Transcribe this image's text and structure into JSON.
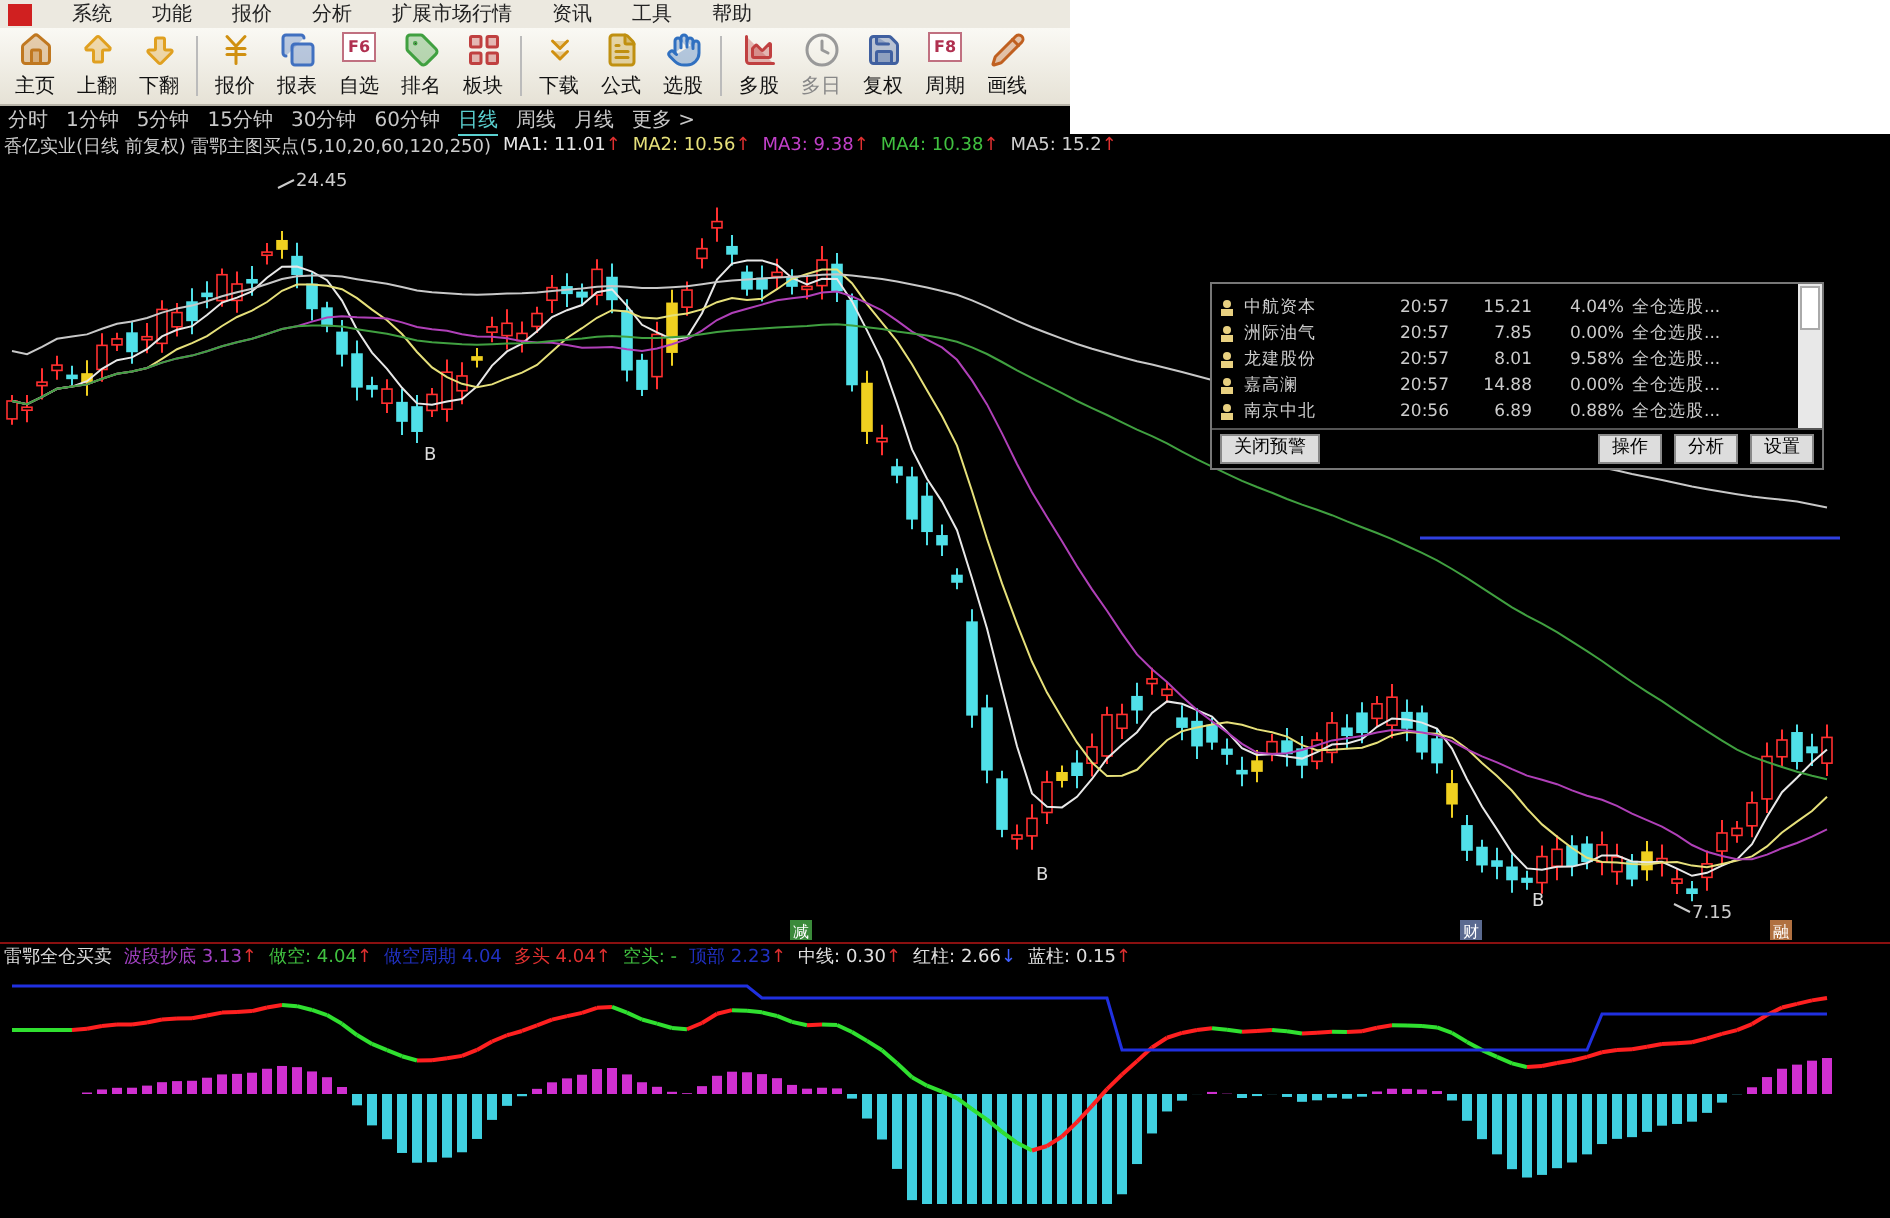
{
  "menu": [
    "系统",
    "功能",
    "报价",
    "分析",
    "扩展市场行情",
    "资讯",
    "工具",
    "帮助"
  ],
  "toolbar": [
    {
      "label": "主页",
      "disabled": false
    },
    {
      "label": "上翻",
      "disabled": false
    },
    {
      "label": "下翻",
      "disabled": false
    },
    {
      "label": "报价",
      "disabled": false
    },
    {
      "label": "报表",
      "disabled": false
    },
    {
      "label": "自选",
      "key": "F6",
      "disabled": false
    },
    {
      "label": "排名",
      "disabled": false
    },
    {
      "label": "板块",
      "disabled": false
    },
    {
      "label": "下载",
      "disabled": false
    },
    {
      "label": "公式",
      "disabled": false
    },
    {
      "label": "选股",
      "disabled": false
    },
    {
      "label": "多股",
      "disabled": false
    },
    {
      "label": "多日",
      "disabled": true
    },
    {
      "label": "复权",
      "disabled": false
    },
    {
      "label": "周期",
      "key": "F8",
      "disabled": false
    },
    {
      "label": "画线",
      "disabled": false
    }
  ],
  "periods": [
    {
      "label": "分时",
      "selected": false
    },
    {
      "label": "1分钟",
      "selected": false
    },
    {
      "label": "5分钟",
      "selected": false
    },
    {
      "label": "15分钟",
      "selected": false
    },
    {
      "label": "30分钟",
      "selected": false
    },
    {
      "label": "60分钟",
      "selected": false
    },
    {
      "label": "日线",
      "selected": true
    },
    {
      "label": "周线",
      "selected": false
    },
    {
      "label": "月线",
      "selected": false
    },
    {
      "label": "更多 >",
      "selected": false
    }
  ],
  "chart_title": "香亿实业(日线 前复权) 雷鄂主图买点(5,10,20,60,120,250)",
  "ma": [
    {
      "label": "MA1: 11.01",
      "color": "#e8e8e8"
    },
    {
      "label": "MA2: 10.56",
      "color": "#e6e07a"
    },
    {
      "label": "MA3: 9.38",
      "color": "#c040c8"
    },
    {
      "label": "MA4: 10.38",
      "color": "#40c040"
    },
    {
      "label": "MA5: 15.2",
      "color": "#d0d0d0"
    }
  ],
  "price_labels": [
    "24.45",
    "7.15"
  ],
  "buy_marks": [
    "B",
    "B",
    "B"
  ],
  "event_tags": [
    {
      "text": "减",
      "color": "#3a8a3a"
    },
    {
      "text": "财",
      "color": "#5a6a90"
    },
    {
      "text": "融",
      "color": "#b07040"
    }
  ],
  "alert_panel": {
    "rows": [
      {
        "name": "中航资本",
        "time": "20:57",
        "price": "15.21",
        "change": "4.04%",
        "strategy": "全仓选股..."
      },
      {
        "name": "洲际油气",
        "time": "20:57",
        "price": "7.85",
        "change": "0.00%",
        "strategy": "全仓选股..."
      },
      {
        "name": "龙建股份",
        "time": "20:57",
        "price": "8.01",
        "change": "9.58%",
        "strategy": "全仓选股..."
      },
      {
        "name": "嘉高澜",
        "time": "20:57",
        "price": "14.88",
        "change": "0.00%",
        "strategy": "全仓选股..."
      },
      {
        "name": "南京中北",
        "time": "20:56",
        "price": "6.89",
        "change": "0.88%",
        "strategy": "全仓选股..."
      }
    ],
    "close_button": "关闭预警",
    "buttons": [
      "操作",
      "分析",
      "设置"
    ]
  },
  "indicator": {
    "title": "雷鄂全仓买卖",
    "values": [
      {
        "label": "波段抄底",
        "value": "3.13",
        "arrow": "↑",
        "color": "#a040c0"
      },
      {
        "label": "做空:",
        "value": "4.04",
        "arrow": "↑",
        "color": "#40c040"
      },
      {
        "label": "做空周期",
        "value": "4.04",
        "color": "#2030c0"
      },
      {
        "label": "多头",
        "value": "4.04",
        "arrow": "↑",
        "color": "#e03030"
      },
      {
        "label": "空头:",
        "value": "-",
        "color": "#40c040"
      },
      {
        "label": "顶部",
        "value": "2.23",
        "arrow": "↑",
        "color": "#2030c0"
      },
      {
        "label": "中线:",
        "value": "0.30",
        "arrow": "↑",
        "color": "#e0e0e0"
      },
      {
        "label": "红柱:",
        "value": "2.66",
        "arrow": "↓",
        "color": "#e0e0e0"
      },
      {
        "label": "蓝柱:",
        "value": "0.15",
        "arrow": "↑",
        "color": "#e0e0e0"
      }
    ]
  }
}
